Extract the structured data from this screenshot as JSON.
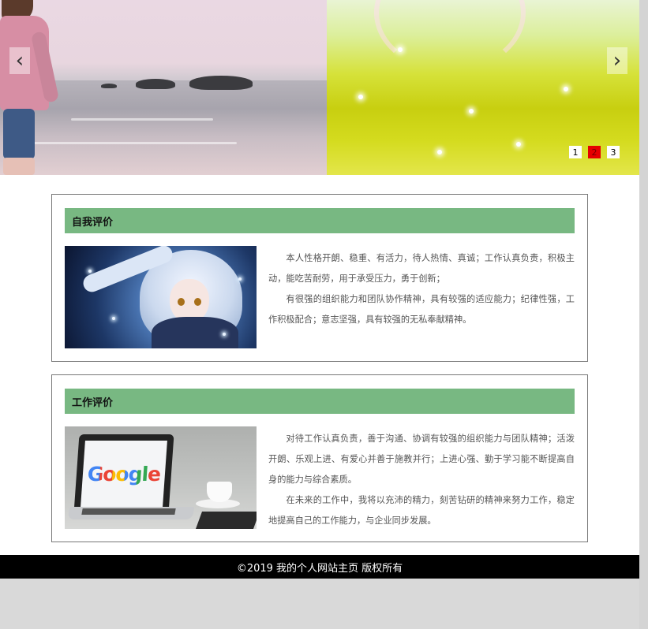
{
  "slider": {
    "prev_arrow": "‹",
    "next_arrow": "›",
    "pages": [
      "1",
      "2",
      "3"
    ],
    "active_page": "2",
    "active_color": "#e60000"
  },
  "sections": [
    {
      "title": "自我评价",
      "image_icon": "anime-girl-illustration",
      "paragraphs": [
        "本人性格开朗、稳重、有活力，待人热情、真诚；工作认真负责，积极主动，能吃苦耐劳，用于承受压力，勇于创新；",
        "有很强的组织能力和团队协作精神，具有较强的适应能力；纪律性强，工作积极配合；意志坚强，具有较强的无私奉献精神。"
      ]
    },
    {
      "title": "工作评价",
      "image_icon": "laptop-google-illustration",
      "image_text": "Google",
      "paragraphs": [
        "对待工作认真负责，善于沟通、协调有较强的组织能力与团队精神；活泼开朗、乐观上进、有爱心并善于施教并行；上进心强、勤于学习能不断提高自身的能力与综合素质。",
        "在未来的工作中，我将以充沛的精力，刻苦钻研的精神来努力工作，稳定地提高自己的工作能力，与企业同步发展。"
      ]
    }
  ],
  "footer": {
    "text": "©2019 我的个人网站主页 版权所有"
  },
  "colors": {
    "section_header": "#78b882",
    "footer_bg": "#000000"
  }
}
